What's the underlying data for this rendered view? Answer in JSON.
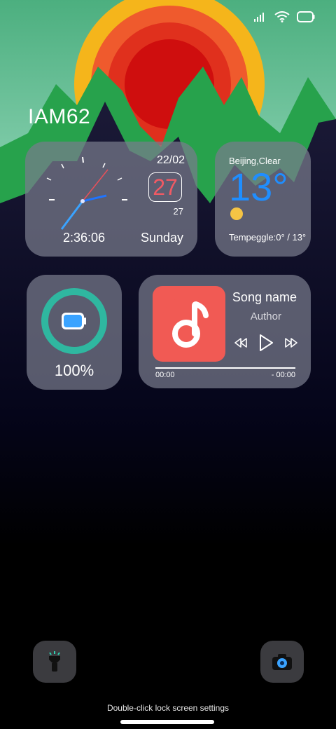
{
  "lockscreen": {
    "title": "IAM62",
    "hint": "Double-click lock screen settings"
  },
  "clock": {
    "date": "22/02",
    "calendar_day": "27",
    "small_day": "27",
    "time": "2:36:06",
    "weekday": "Sunday"
  },
  "weather": {
    "city_condition": "Beijing,Clear",
    "temperature": "13°",
    "range_label": "Tempeggle:0° / 13°",
    "icon": "sun-icon"
  },
  "battery": {
    "percent_label": "100%",
    "level": 1.0,
    "ring_color": "#2fb7a0",
    "icon_color": "#3aa3ff"
  },
  "music": {
    "song": "Song name",
    "author": "Author",
    "time_start": "00:00",
    "time_end": "- 00:00",
    "album_color": "#f15a54",
    "icons": [
      "music-note-icon",
      "prev-icon",
      "play-icon",
      "next-icon"
    ]
  },
  "quick_actions": {
    "left": "flashlight-icon",
    "right": "camera-icon"
  },
  "status_bar": {
    "icons": [
      "signal-icon",
      "wifi-icon",
      "battery-icon"
    ]
  }
}
